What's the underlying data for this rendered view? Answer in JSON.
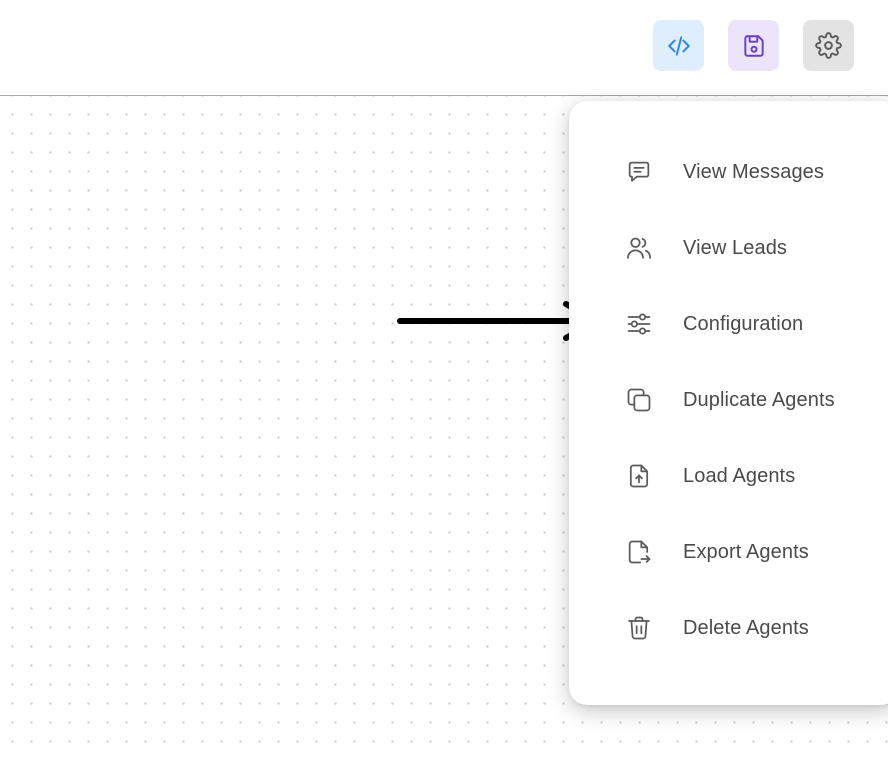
{
  "toolbar": {
    "buttons": [
      {
        "icon": "code-icon",
        "color": "#2f86e6",
        "background": "#dfeefc"
      },
      {
        "icon": "floppy-disk-icon",
        "color": "#6a3fc7",
        "background": "#ece4fa"
      },
      {
        "icon": "gear-icon",
        "color": "#5a5a5a",
        "background": "#e3e3e3"
      }
    ]
  },
  "menu": {
    "items": [
      {
        "label": "View Messages",
        "icon": "message-square-icon"
      },
      {
        "label": "View Leads",
        "icon": "users-icon"
      },
      {
        "label": "Configuration",
        "icon": "sliders-icon"
      },
      {
        "label": "Duplicate Agents",
        "icon": "copy-icon"
      },
      {
        "label": "Load Agents",
        "icon": "file-upload-icon"
      },
      {
        "label": "Export Agents",
        "icon": "file-export-icon"
      },
      {
        "label": "Delete Agents",
        "icon": "trash-icon"
      }
    ]
  },
  "annotation": {
    "icon": "pointer-arrow-icon",
    "color": "#000000"
  },
  "colors": {
    "menu_text": "#4a4a4a",
    "icon_stroke": "#5a5a5a",
    "canvas_dot": "#c9c9c9"
  }
}
